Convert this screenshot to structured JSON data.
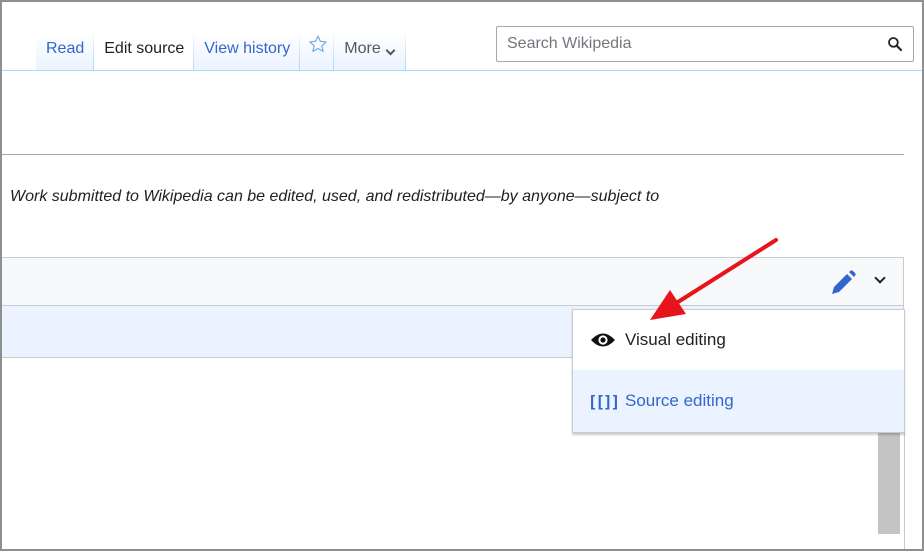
{
  "tabs": {
    "read": "Read",
    "edit_source": "Edit source",
    "view_history": "View history",
    "more": "More"
  },
  "search": {
    "placeholder": "Search Wikipedia"
  },
  "notice": "Work submitted to Wikipedia can be edited, used, and redistributed—by anyone—subject to",
  "editor_menu": {
    "visual_editing": "Visual editing",
    "source_editing": "Source editing",
    "source_icon_text": "[[]]"
  },
  "colors": {
    "link": "#3366cc",
    "tab_border": "#a7d7f9",
    "menu_highlight": "#eaf3ff",
    "annotation_arrow": "#e8141b"
  },
  "icons": [
    "star-icon",
    "chevron-down-icon",
    "search-icon",
    "pencil-icon",
    "eye-icon"
  ]
}
